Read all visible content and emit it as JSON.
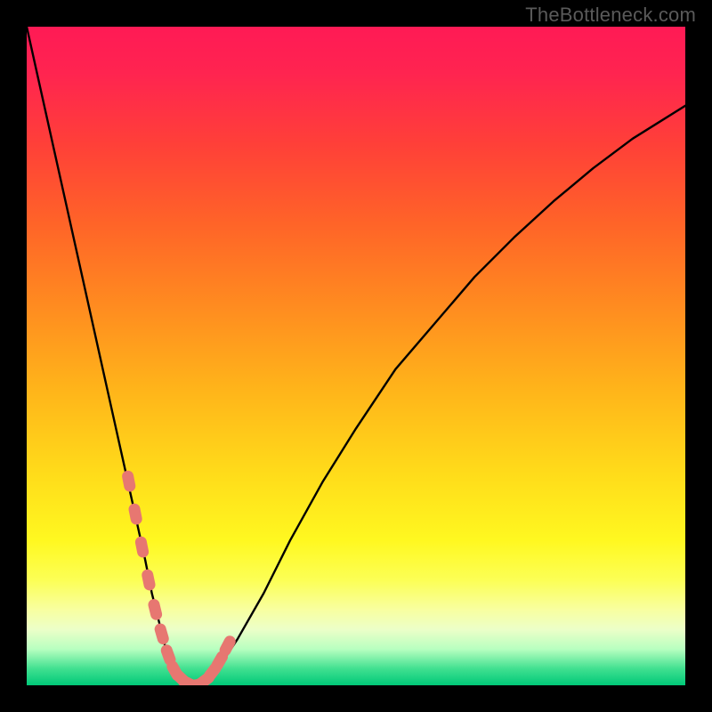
{
  "watermark": "TheBottleneck.com",
  "gradient_stops": [
    {
      "offset": 0.0,
      "color": "#ff1a55"
    },
    {
      "offset": 0.07,
      "color": "#ff2450"
    },
    {
      "offset": 0.18,
      "color": "#ff4038"
    },
    {
      "offset": 0.3,
      "color": "#ff6428"
    },
    {
      "offset": 0.42,
      "color": "#ff8a20"
    },
    {
      "offset": 0.55,
      "color": "#ffb41a"
    },
    {
      "offset": 0.68,
      "color": "#ffdc1a"
    },
    {
      "offset": 0.78,
      "color": "#fff820"
    },
    {
      "offset": 0.84,
      "color": "#fcff55"
    },
    {
      "offset": 0.885,
      "color": "#f8ffa0"
    },
    {
      "offset": 0.915,
      "color": "#ecffc8"
    },
    {
      "offset": 0.945,
      "color": "#b8ffc0"
    },
    {
      "offset": 0.975,
      "color": "#40e090"
    },
    {
      "offset": 1.0,
      "color": "#00c878"
    }
  ],
  "chart_data": {
    "type": "line",
    "title": "",
    "xlabel": "",
    "ylabel": "",
    "x_range": [
      0,
      100
    ],
    "y_range": [
      0,
      100
    ],
    "series": [
      {
        "name": "bottleneck-curve",
        "x": [
          0,
          2,
          4,
          6,
          8,
          10,
          12,
          14,
          16,
          18,
          19,
          20,
          21,
          22,
          23,
          24,
          25.5,
          27,
          29,
          32,
          36,
          40,
          45,
          50,
          56,
          62,
          68,
          74,
          80,
          86,
          92,
          96,
          100
        ],
        "values": [
          100,
          91,
          82,
          73,
          64,
          55,
          46,
          37,
          28,
          19,
          14,
          10,
          6,
          3,
          1.3,
          0.4,
          0.0,
          0.5,
          2.5,
          7,
          14,
          22,
          31,
          39,
          48,
          55,
          62,
          68,
          73.5,
          78.5,
          83,
          85.5,
          88
        ]
      }
    ],
    "markers": {
      "name": "highlighted-points",
      "color": "#e77771",
      "x": [
        15.5,
        16.5,
        17.5,
        18.5,
        19.5,
        20.5,
        21.5,
        22.5,
        23.5,
        24.5,
        25.5,
        27.0,
        28.2,
        29.3,
        30.5
      ],
      "values": [
        31,
        26,
        21,
        16,
        11.5,
        7.8,
        4.6,
        2.2,
        1.0,
        0.3,
        0.0,
        0.7,
        2.0,
        3.7,
        6.0
      ]
    }
  }
}
